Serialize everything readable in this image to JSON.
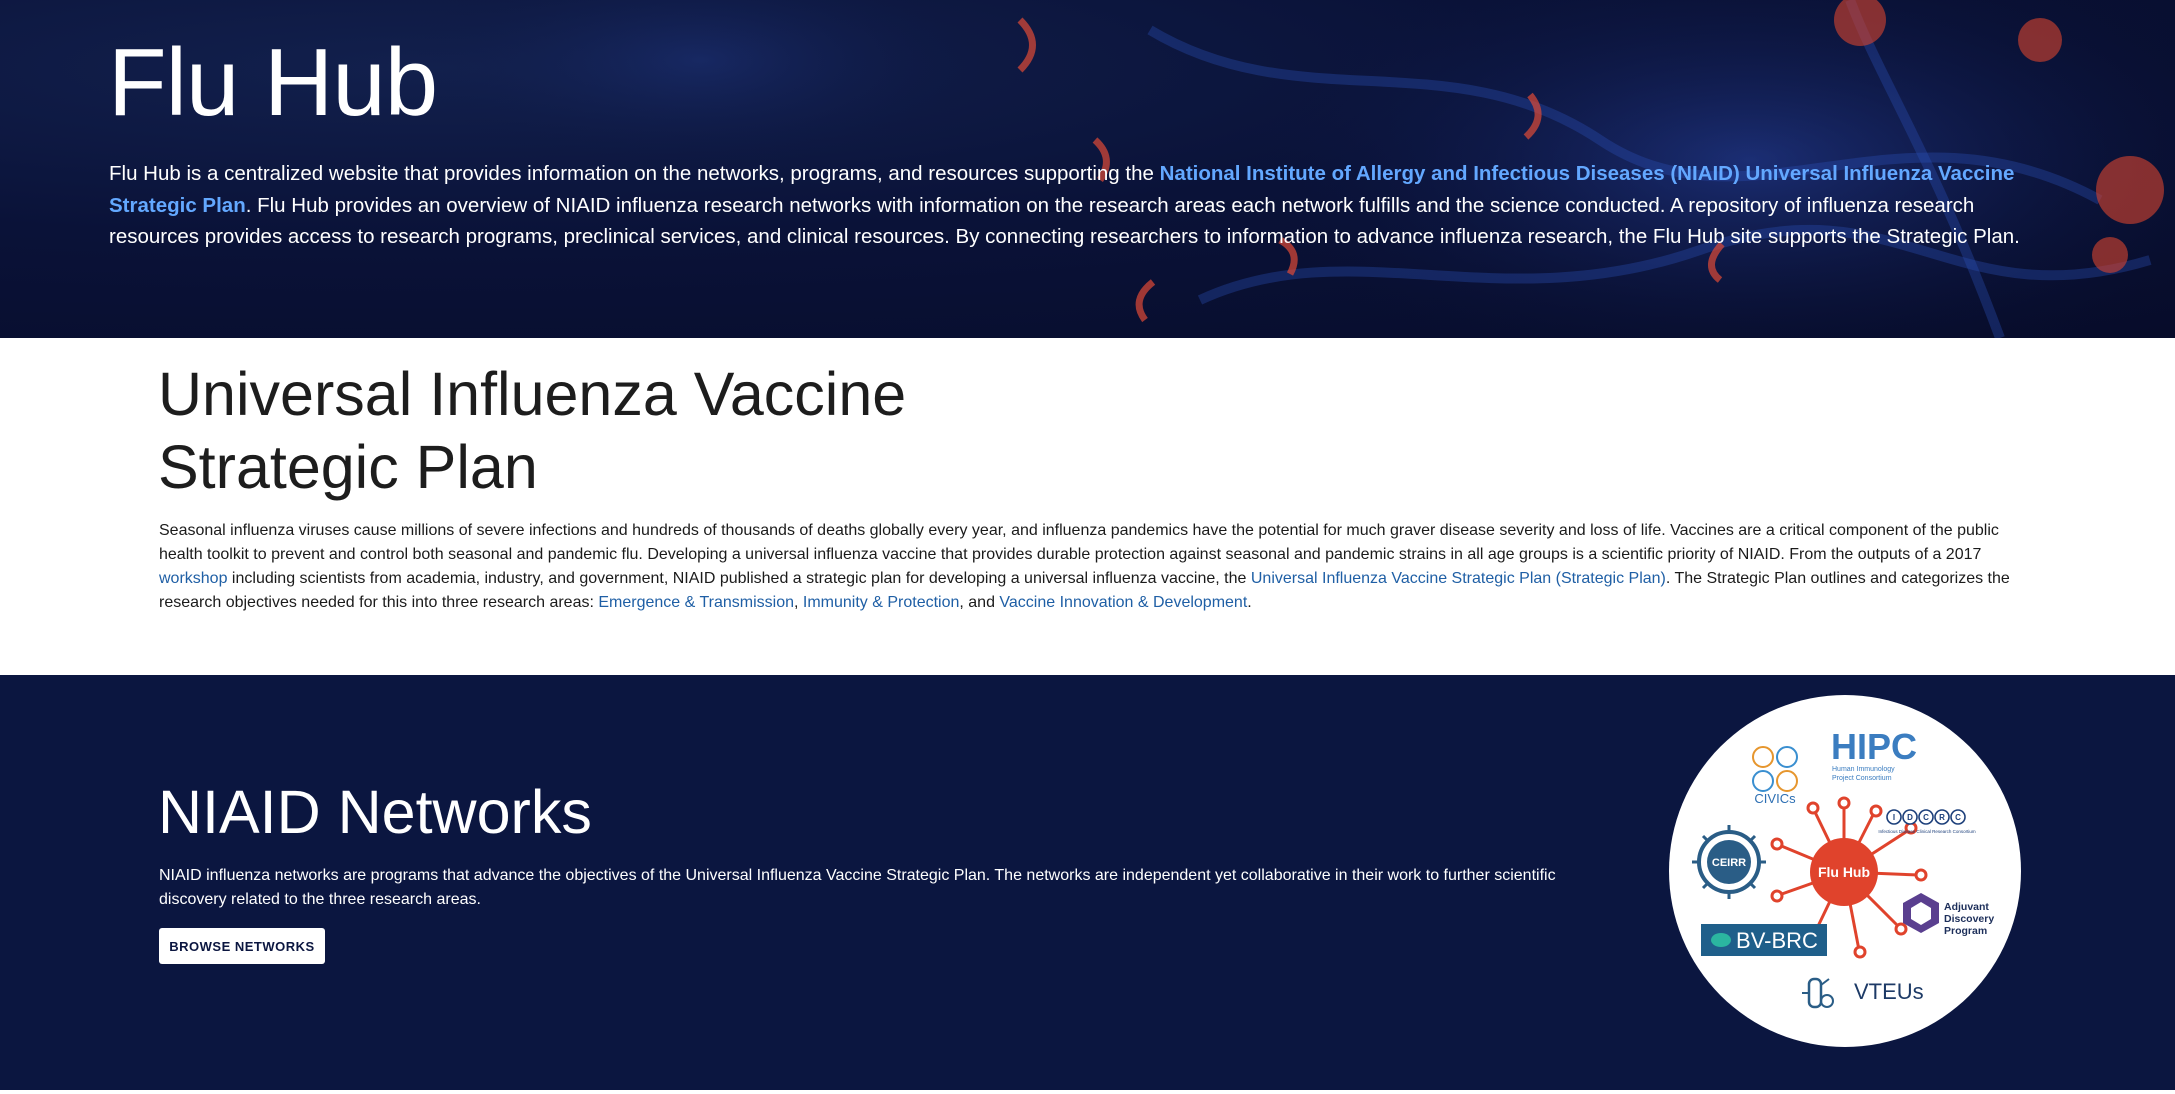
{
  "hero": {
    "title": "Flu Hub",
    "text_1": "Flu Hub is a centralized website that provides information on the networks, programs, and resources supporting the ",
    "link": "National Institute of Allergy and Infectious Diseases (NIAID) Universal Influenza Vaccine Strategic Plan",
    "text_2": ". Flu Hub provides an overview of NIAID influenza research networks with information on the research areas each network fulfills and the science conducted. A repository of influenza research resources provides access to research programs, preclinical services, and clinical resources. By connecting researchers to information to advance influenza research, the Flu Hub site supports the Strategic Plan."
  },
  "plan": {
    "title": "Universal Influenza Vaccine Strategic Plan",
    "text_1": "Seasonal influenza viruses cause millions of severe infections and hundreds of thousands of deaths globally every year, and influenza pandemics have the potential for much graver disease severity and loss of life. Vaccines are a critical component of the public health toolkit to prevent and control both seasonal and pandemic flu. Developing a universal influenza vaccine that provides durable protection against seasonal and pandemic strains in all age groups is a scientific priority of NIAID. From the outputs of a 2017 ",
    "workshop_link": "workshop",
    "text_2": " including scientists from academia, industry, and government, NIAID published a strategic plan for developing a universal influenza vaccine, the ",
    "plan_link": "Universal Influenza Vaccine Strategic Plan (Strategic Plan)",
    "text_3": ". The Strategic Plan outlines and categorizes the research objectives needed for this into three research areas: ",
    "area_1": "Emergence & Transmission",
    "sep_1": ", ",
    "area_2": "Immunity & Protection",
    "sep_2": ", and ",
    "area_3": "Vaccine Innovation & Development",
    "end": "."
  },
  "networks": {
    "title": "NIAID Networks",
    "text": "NIAID influenza networks are programs that advance the objectives of the Universal Influenza Vaccine Strategic Plan. The networks are independent yet collaborative in their work to further scientific discovery related to the three research areas.",
    "button": "BROWSE NETWORKS",
    "graphic": {
      "center": "Flu Hub",
      "civics": "CIVICs",
      "hipc": "HIPC",
      "hipc_sub_1": "Human Immunology",
      "hipc_sub_2": "Project Consortium",
      "idcrc": "IDCRC",
      "idcrc_sub": "Infectious Disease Clinical Research Consortium",
      "ceirr": "CEIRR",
      "adjuvant_1": "Adjuvant",
      "adjuvant_2": "Discovery",
      "adjuvant_3": "Program",
      "bvbrc": "BV-BRC",
      "vteus": "VTEUs"
    }
  },
  "colors": {
    "hero_bg": "#070c2a",
    "hero_link": "#63a8ff",
    "body_link": "#1f5fa5",
    "networks_bg": "#0b1640",
    "hub_red": "#e0432c"
  }
}
